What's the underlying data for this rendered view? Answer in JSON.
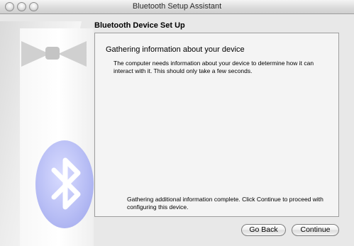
{
  "window": {
    "title": "Bluetooth Setup Assistant"
  },
  "page": {
    "heading": "Bluetooth Device Set Up"
  },
  "panel": {
    "title": "Gathering information about your device",
    "description": "The computer needs information about your device to determine how it can interact with it. This should only take a few seconds.",
    "status": "Gathering additional information complete. Click Continue to proceed with configuring this device."
  },
  "buttons": {
    "go_back": "Go Back",
    "continue": "Continue"
  },
  "icons": {
    "close": "close-icon",
    "minimize": "minimize-icon",
    "zoom": "zoom-icon",
    "bluetooth": "bluetooth-icon"
  },
  "colors": {
    "window_bg": "#e8e8e8",
    "panel_bg": "#f4f4f4",
    "bluetooth_badge": "#b8bef5"
  }
}
